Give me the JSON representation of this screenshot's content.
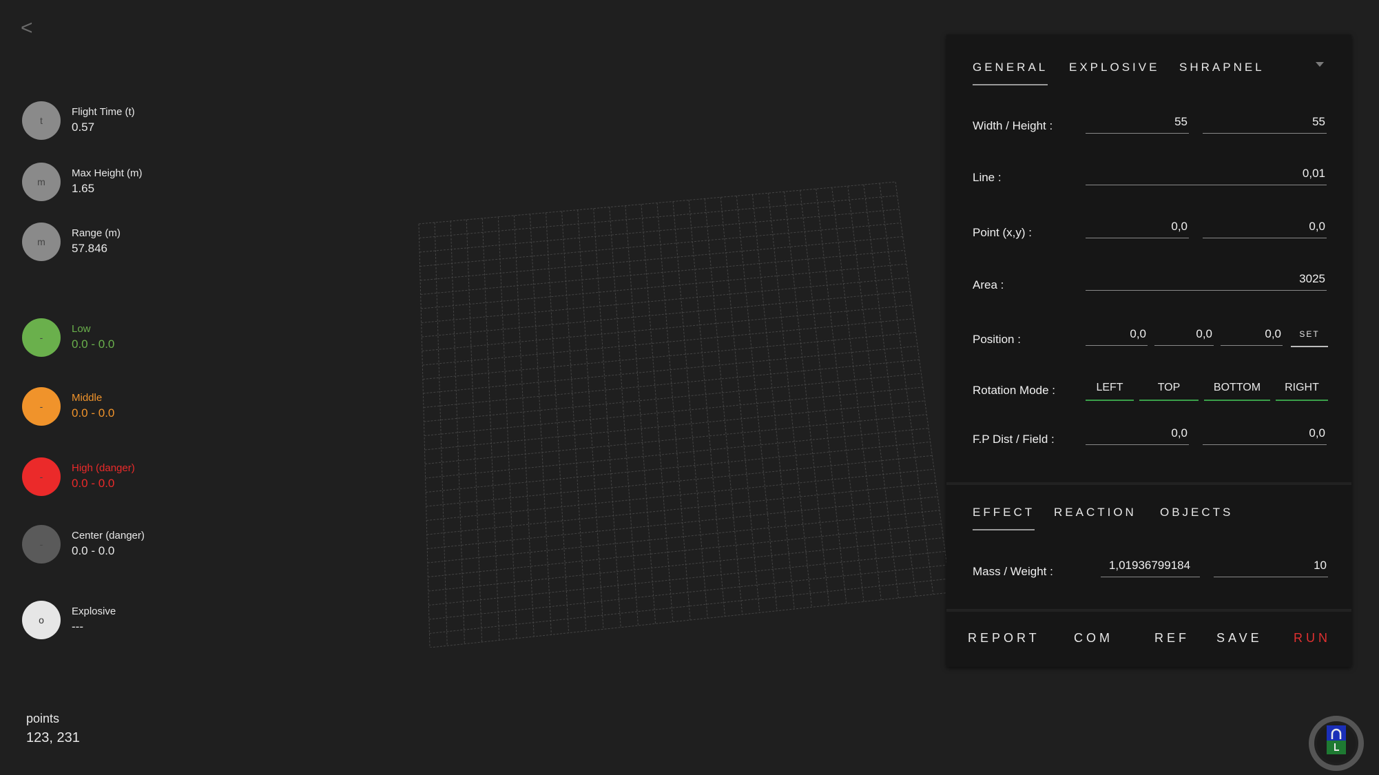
{
  "nav": {
    "back_glyph": "<"
  },
  "legend": {
    "stats": [
      {
        "icon": "t",
        "label": "Flight Time (t)",
        "value": "0.57",
        "color": "#8a8a8a"
      },
      {
        "icon": "m",
        "label": "Max Height (m)",
        "value": "1.65",
        "color": "#8a8a8a"
      },
      {
        "icon": "m",
        "label": "Range (m)",
        "value": "57.846",
        "color": "#8a8a8a"
      }
    ],
    "zones": [
      {
        "icon": "-",
        "label": "Low",
        "value": "0.0 - 0.0",
        "color": "#6ab04c"
      },
      {
        "icon": "-",
        "label": "Middle",
        "value": "0.0 - 0.0",
        "color": "#f0932b"
      },
      {
        "icon": "-",
        "label": "High (danger)",
        "value": "0.0 - 0.0",
        "color": "#eb2a2a"
      },
      {
        "icon": "-",
        "label": "Center (danger)",
        "value": "0.0 - 0.0",
        "color": "#5a5a5a"
      },
      {
        "icon": "o",
        "label": "Explosive",
        "value": "---",
        "color": "#e6e6e6"
      }
    ]
  },
  "points": {
    "label": "points",
    "value": "123, 231"
  },
  "panel": {
    "tabs": [
      "GENERAL",
      "EXPLOSIVE",
      "SHRAPNEL"
    ],
    "rows": {
      "width_height": {
        "label": "Width / Height :",
        "width": "55",
        "height": "55"
      },
      "line": {
        "label": "Line :",
        "value": "0,01"
      },
      "point": {
        "label": "Point (x,y) :",
        "x": "0,0",
        "y": "0,0"
      },
      "area": {
        "label": "Area :",
        "value": "3025"
      },
      "position": {
        "label": "Position :",
        "x": "0,0",
        "y": "0,0",
        "z": "0,0",
        "set_label": "SET"
      },
      "rotation": {
        "label": "Rotation Mode :",
        "modes": [
          "LEFT",
          "TOP",
          "BOTTOM",
          "RIGHT"
        ]
      },
      "fp": {
        "label": "F.P Dist / Field :",
        "dist": "0,0",
        "field": "0,0"
      }
    },
    "tabs2": [
      "EFFECT",
      "REACTION",
      "OBJECTS"
    ],
    "mass": {
      "label": "Mass / Weight :",
      "mass": "1,01936799184",
      "weight": "10"
    },
    "actions": [
      "REPORT",
      "COM",
      "REF",
      "SAVE",
      "RUN"
    ],
    "run_color": "#e03030"
  }
}
